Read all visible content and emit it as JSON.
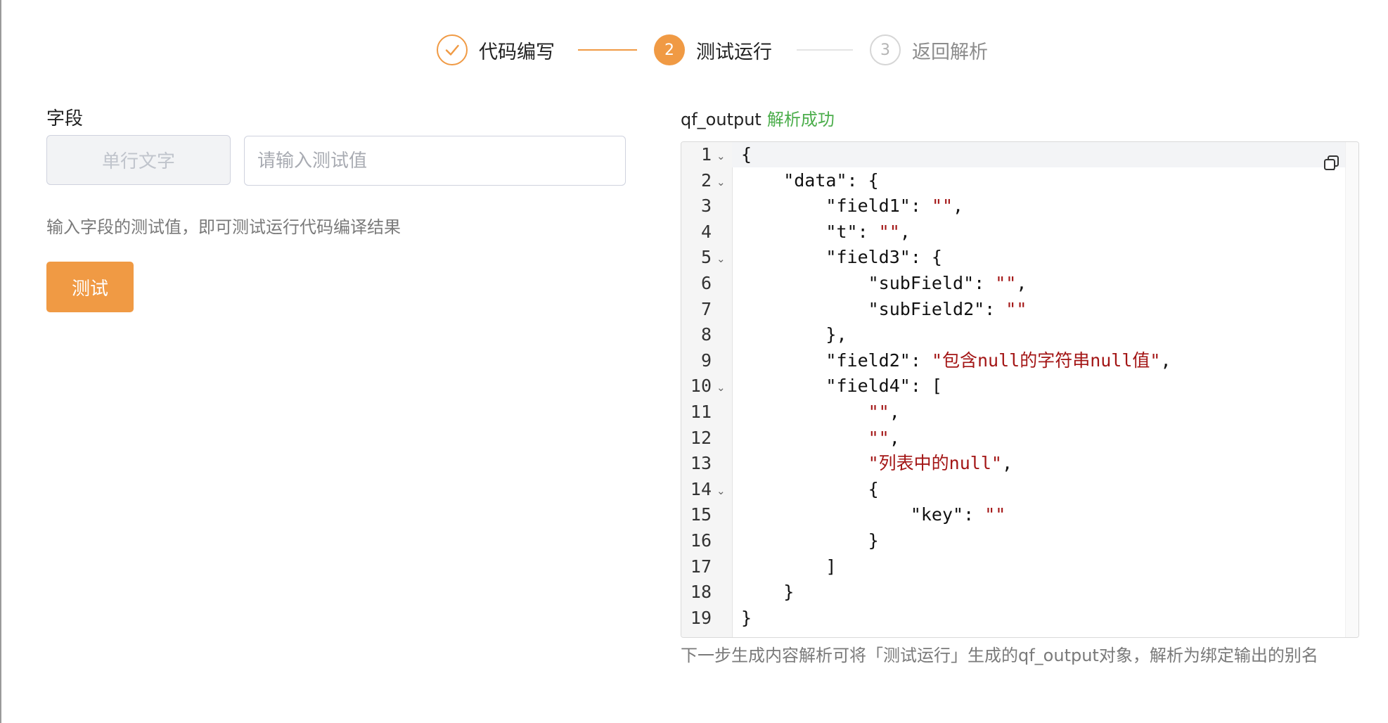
{
  "stepper": {
    "steps": [
      {
        "index": "1",
        "label": "代码编写",
        "state": "done"
      },
      {
        "index": "2",
        "label": "测试运行",
        "state": "active"
      },
      {
        "index": "3",
        "label": "返回解析",
        "state": "todo"
      }
    ]
  },
  "colors": {
    "accent": "#f09a44",
    "success": "#4cae4c",
    "json_string": "#a31515"
  },
  "form": {
    "field_label": "字段",
    "field_type": "单行文字",
    "value_placeholder": "请输入测试值",
    "value": "",
    "hint": "输入字段的测试值，即可测试运行代码编译结果",
    "test_button_label": "测试"
  },
  "output": {
    "name": "qf_output",
    "status": "解析成功",
    "copy_icon": "copy-icon",
    "lines": [
      {
        "num": "1",
        "fold": true,
        "text": "{"
      },
      {
        "num": "2",
        "fold": true,
        "text": "    \"data\": {"
      },
      {
        "num": "3",
        "fold": false,
        "text": "        \"field1\": \"\","
      },
      {
        "num": "4",
        "fold": false,
        "text": "        \"t\": \"\","
      },
      {
        "num": "5",
        "fold": true,
        "text": "        \"field3\": {"
      },
      {
        "num": "6",
        "fold": false,
        "text": "            \"subField\": \"\","
      },
      {
        "num": "7",
        "fold": false,
        "text": "            \"subField2\": \"\""
      },
      {
        "num": "8",
        "fold": false,
        "text": "        },"
      },
      {
        "num": "9",
        "fold": false,
        "text": "        \"field2\": \"包含null的字符串null值\","
      },
      {
        "num": "10",
        "fold": true,
        "text": "        \"field4\": ["
      },
      {
        "num": "11",
        "fold": false,
        "text": "            \"\","
      },
      {
        "num": "12",
        "fold": false,
        "text": "            \"\","
      },
      {
        "num": "13",
        "fold": false,
        "text": "            \"列表中的null\","
      },
      {
        "num": "14",
        "fold": true,
        "text": "            {"
      },
      {
        "num": "15",
        "fold": false,
        "text": "                \"key\": \"\""
      },
      {
        "num": "16",
        "fold": false,
        "text": "            }"
      },
      {
        "num": "17",
        "fold": false,
        "text": "        ]"
      },
      {
        "num": "18",
        "fold": false,
        "text": "    }"
      },
      {
        "num": "19",
        "fold": false,
        "text": "}"
      }
    ],
    "footnote": "下一步生成内容解析可将「测试运行」生成的qf_output对象，解析为绑定输出的别名"
  }
}
